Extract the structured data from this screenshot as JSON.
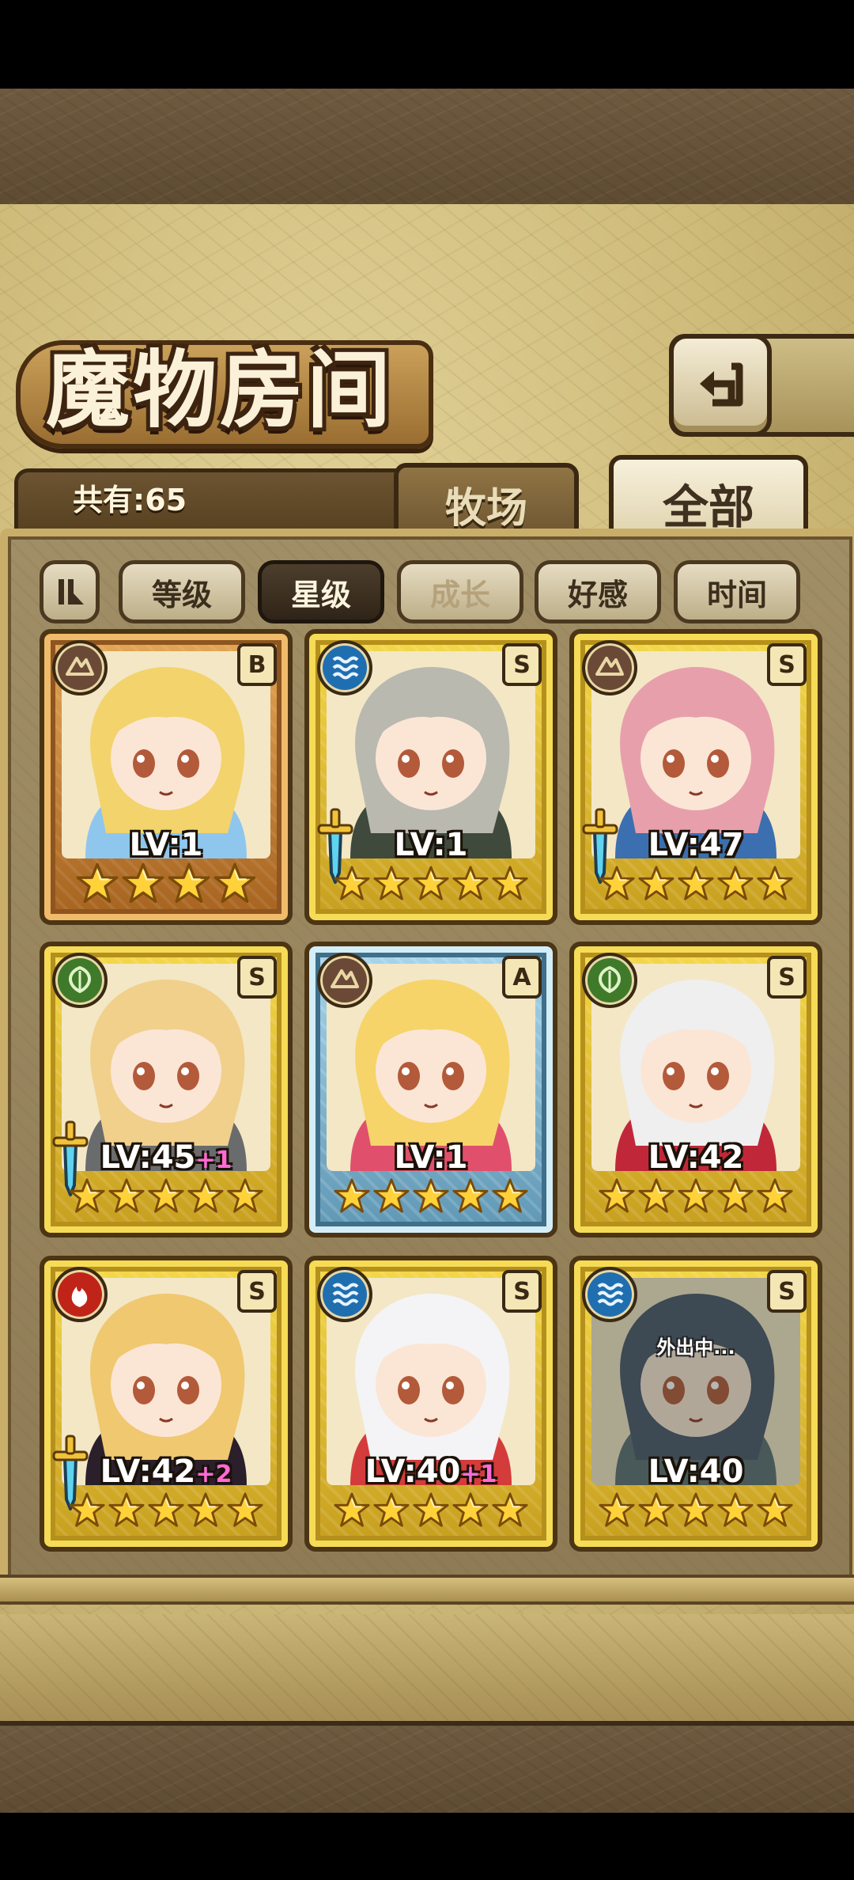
{
  "header": {
    "title": "魔物房间",
    "total_count": "共有:65"
  },
  "tabs": [
    {
      "label": "牧场",
      "selected": false
    },
    {
      "label": "全部",
      "selected": true
    }
  ],
  "sort": [
    {
      "label": "等级",
      "state": "normal"
    },
    {
      "label": "星级",
      "state": "active"
    },
    {
      "label": "成长",
      "state": "disabled"
    },
    {
      "label": "好感",
      "state": "normal"
    },
    {
      "label": "时间",
      "state": "normal"
    }
  ],
  "monsters": [
    {
      "element": "earth",
      "rank": "B",
      "frame": "bronze",
      "level": "LV:1",
      "plus": "",
      "stars": 4,
      "weapon": false,
      "status": ""
    },
    {
      "element": "water",
      "rank": "S",
      "frame": "gold",
      "level": "LV:1",
      "plus": "",
      "stars": 5,
      "weapon": true,
      "status": ""
    },
    {
      "element": "earth",
      "rank": "S",
      "frame": "gold",
      "level": "LV:47",
      "plus": "",
      "stars": 5,
      "weapon": true,
      "status": ""
    },
    {
      "element": "leaf",
      "rank": "S",
      "frame": "gold",
      "level": "LV:45",
      "plus": "+1",
      "stars": 5,
      "weapon": true,
      "status": ""
    },
    {
      "element": "earth",
      "rank": "A",
      "frame": "silver",
      "level": "LV:1",
      "plus": "",
      "stars": 5,
      "weapon": false,
      "status": ""
    },
    {
      "element": "leaf",
      "rank": "S",
      "frame": "gold",
      "level": "LV:42",
      "plus": "",
      "stars": 5,
      "weapon": false,
      "status": ""
    },
    {
      "element": "fire",
      "rank": "S",
      "frame": "gold",
      "level": "LV:42",
      "plus": "+2",
      "stars": 5,
      "weapon": true,
      "status": ""
    },
    {
      "element": "water",
      "rank": "S",
      "frame": "gold",
      "level": "LV:40",
      "plus": "+1",
      "stars": 5,
      "weapon": false,
      "status": ""
    },
    {
      "element": "water",
      "rank": "S",
      "frame": "gold",
      "level": "LV:40",
      "plus": "",
      "stars": 5,
      "weapon": false,
      "status": "外出中..."
    }
  ],
  "colors": {
    "hair": [
      "#f3d36b",
      "#b9b9b0",
      "#e7a0ab",
      "#f1d08c",
      "#f6d46a",
      "#efeff0",
      "#f0c870",
      "#f4f4f6",
      "#49566b"
    ],
    "outfit": [
      "#8ec6ee",
      "#3f4a3c",
      "#3b6fb0",
      "#6a6b6c",
      "#e0506c",
      "#c0283a",
      "#2a1f2a",
      "#d43b3b",
      "#5b6f73"
    ]
  }
}
